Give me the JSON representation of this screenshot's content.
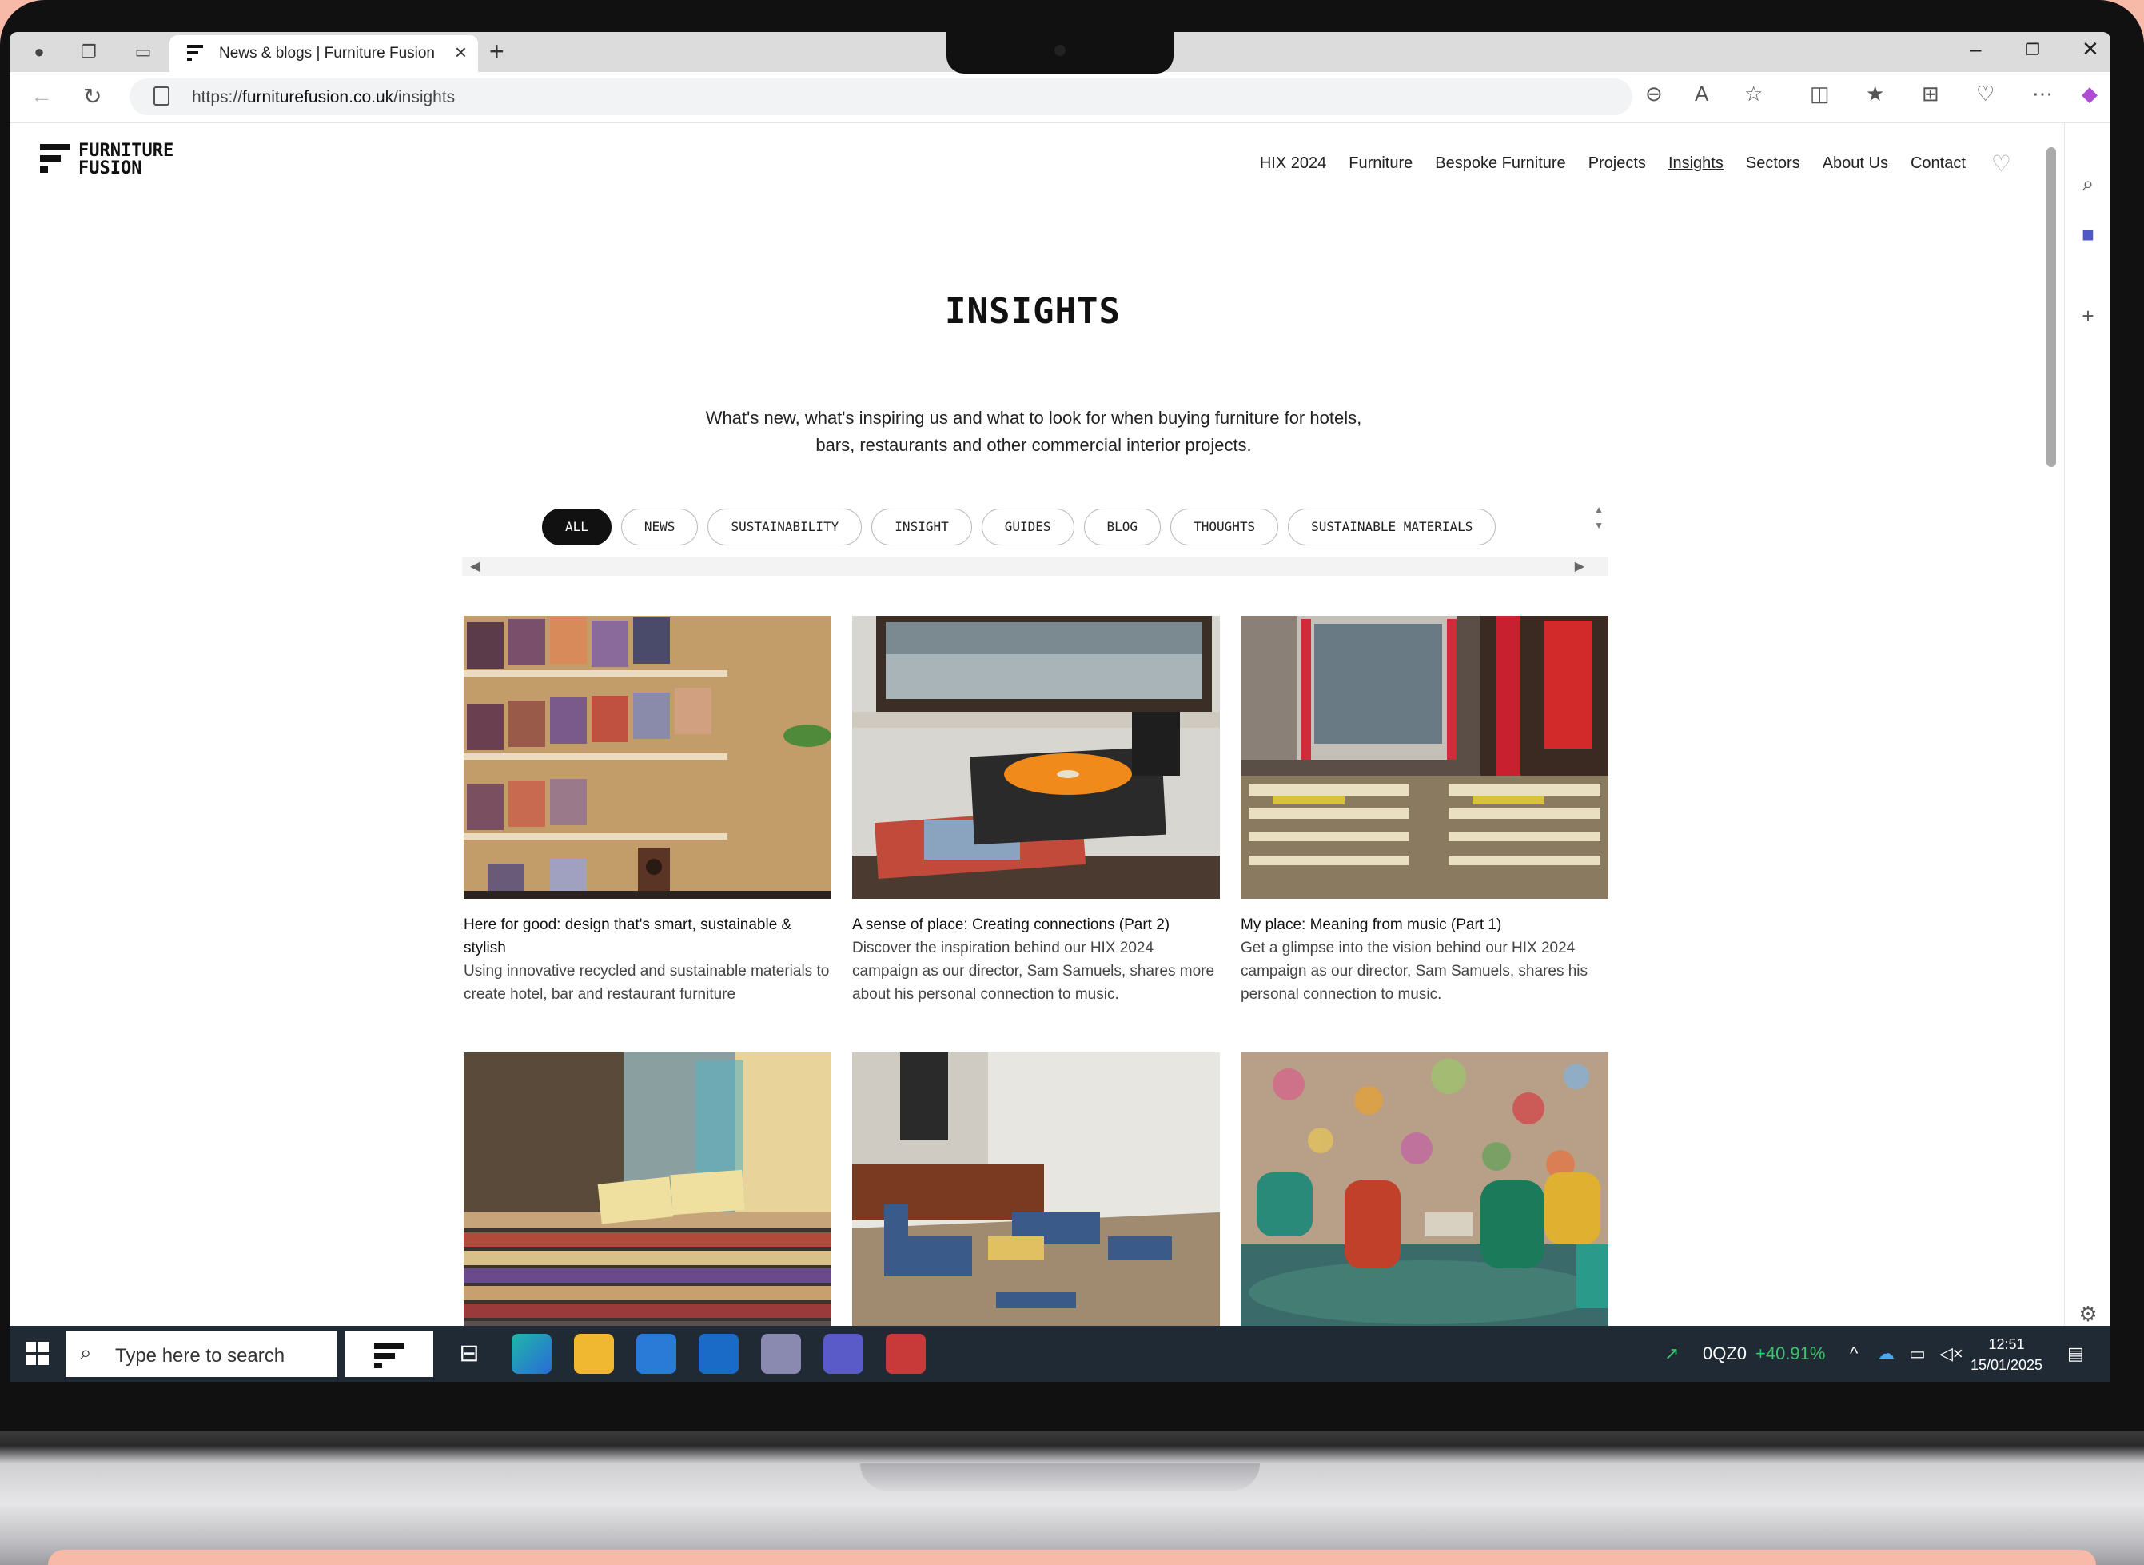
{
  "browser": {
    "tab_title": "News & blogs | Furniture Fusion -",
    "url_prefix": "https://",
    "url_domain": "furniturefusion.co.uk",
    "url_path": "/insights"
  },
  "site": {
    "logo_line1": "FURNITURE",
    "logo_line2": "FUSION",
    "nav": [
      "HIX 2024",
      "Furniture",
      "Bespoke Furniture",
      "Projects",
      "Insights",
      "Sectors",
      "About Us",
      "Contact"
    ],
    "active_nav": "Insights"
  },
  "page": {
    "title": "INSIGHTS",
    "intro_line1": "What's new, what's inspiring us and what to look for when buying furniture for hotels,",
    "intro_line2": "bars, restaurants and other commercial interior projects."
  },
  "filters": [
    "ALL",
    "NEWS",
    "SUSTAINABILITY",
    "INSIGHT",
    "GUIDES",
    "BLOG",
    "THOUGHTS",
    "SUSTAINABLE MATERIALS"
  ],
  "active_filter": "ALL",
  "cards": [
    {
      "title": "Here for good: design that's smart, sustainable & stylish",
      "desc": "Using innovative recycled and sustainable materials to create hotel, bar and restaurant furniture",
      "image": "record-wall-photo"
    },
    {
      "title": "A sense of place: Creating connections (Part 2)",
      "desc": "Discover the inspiration behind our HIX 2024 campaign as our director, Sam Samuels, shares more about his personal connection to music.",
      "image": "turntable-photo"
    },
    {
      "title": "My place: Meaning from music (Part 1)",
      "desc": "Get a glimpse into the vision behind our HIX 2024 campaign as our director, Sam Samuels, shares his personal connection to music.",
      "image": "record-shop-photo"
    },
    {
      "title": "",
      "desc": "",
      "image": "vinyl-crates-photo"
    },
    {
      "title": "",
      "desc": "",
      "image": "blue-lounge-photo"
    },
    {
      "title": "",
      "desc": "",
      "image": "floral-lounge-photo"
    }
  ],
  "taskbar": {
    "search_placeholder": "Type here to search",
    "stock_ticker": "0QZ0",
    "stock_change": "+40.91%",
    "time": "12:51",
    "date": "15/01/2025"
  },
  "colors": {
    "background": "#f7b9a8",
    "accent_dark": "#111111",
    "taskbar": "#1f2a35",
    "stock_up": "#3ac46a"
  }
}
